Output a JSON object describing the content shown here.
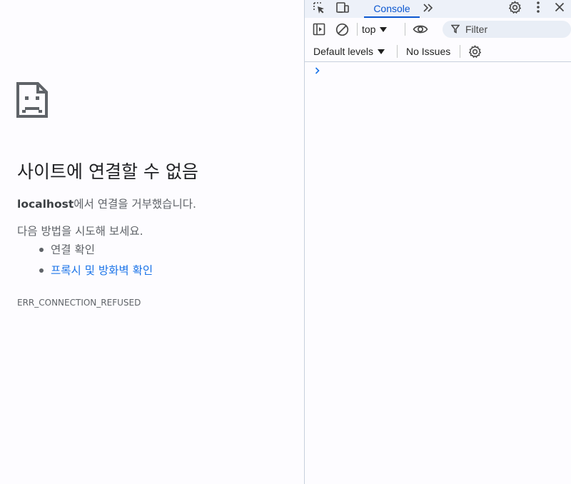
{
  "error_page": {
    "icon": "sad-page-icon",
    "title": "사이트에 연결할 수 없음",
    "host": "localhost",
    "description_suffix": "에서 연결을 거부했습니다.",
    "suggestions_lead": "다음 방법을 시도해 보세요.",
    "suggestions": [
      {
        "label": "연결 확인",
        "is_link": false
      },
      {
        "label": "프록시 및 방화벽 확인",
        "is_link": true
      }
    ],
    "error_code": "ERR_CONNECTION_REFUSED",
    "link_color": "#1a73e8"
  },
  "devtools": {
    "tabbar": {
      "icons": [
        "inspect-element-icon",
        "device-toolbar-icon",
        "settings-icon",
        "more-options-icon",
        "close-icon"
      ],
      "active_tab": "Console",
      "more_tabs": "»",
      "accent_color": "#0b57d0"
    },
    "toolbar": {
      "icons": [
        "show-sidebar-icon",
        "clear-console-icon",
        "live-expression-eye-icon",
        "filter-icon",
        "console-settings-icon"
      ],
      "context": "top",
      "filter_placeholder": "Filter",
      "levels": "Default levels",
      "issues": "No Issues"
    },
    "console": {
      "prompt": "prompt-caret-icon",
      "prompt_color": "#1a73e8"
    }
  }
}
